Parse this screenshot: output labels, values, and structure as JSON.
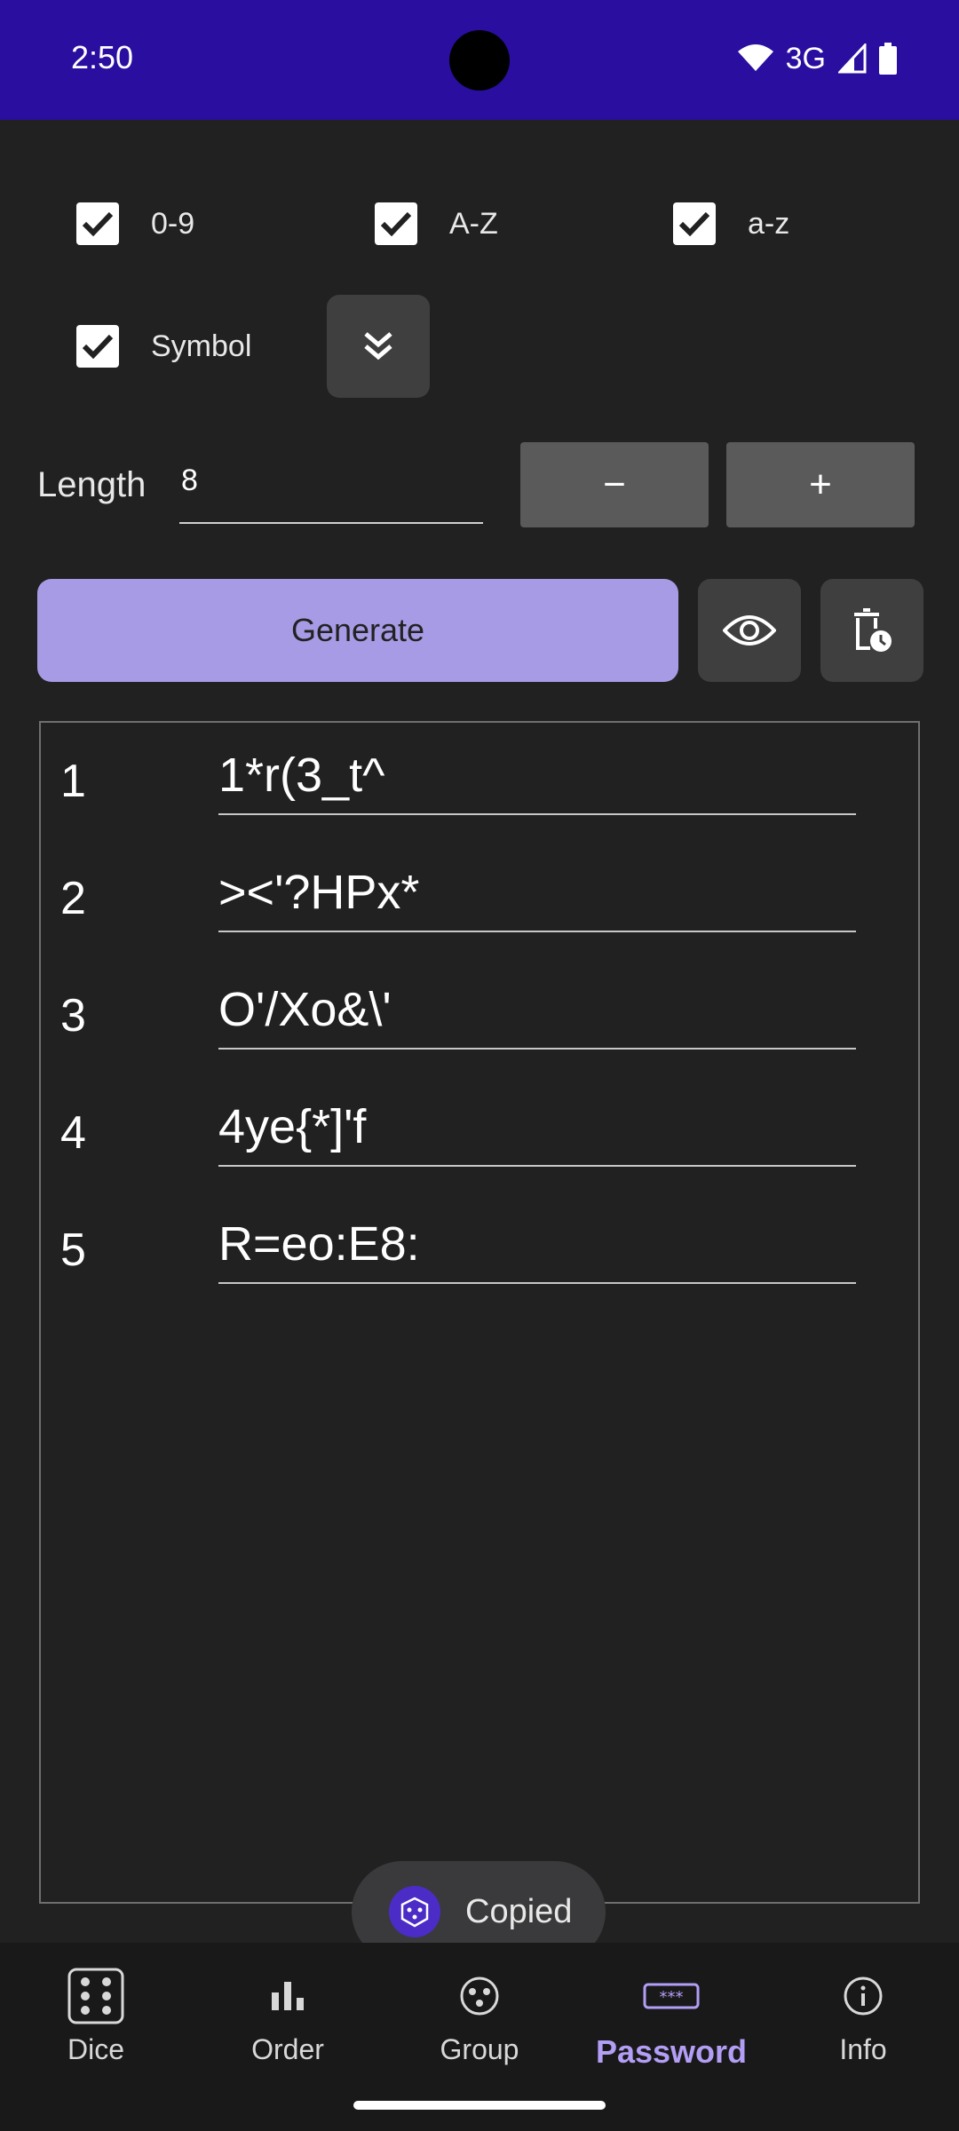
{
  "status_bar": {
    "time": "2:50",
    "network": "3G"
  },
  "options": {
    "digits": {
      "label": "0-9",
      "checked": true
    },
    "upper": {
      "label": "A-Z",
      "checked": true
    },
    "lower": {
      "label": "a-z",
      "checked": true
    },
    "symbol": {
      "label": "Symbol",
      "checked": true
    }
  },
  "length": {
    "label": "Length",
    "value": "8",
    "decrement": "−",
    "increment": "+"
  },
  "generate_label": "Generate",
  "passwords": [
    {
      "index": "1",
      "value": "1*r(3_t^"
    },
    {
      "index": "2",
      "value": "><'?HPx*"
    },
    {
      "index": "3",
      "value": "O'/Xo&\\'"
    },
    {
      "index": "4",
      "value": "4ye{*]'f"
    },
    {
      "index": "5",
      "value": "R=eo:E8:"
    }
  ],
  "toast": {
    "text": "Copied",
    "icon": "dice-icon"
  },
  "nav": {
    "items": [
      {
        "label": "Dice",
        "icon": "dice-icon"
      },
      {
        "label": "Order",
        "icon": "bar-chart-icon"
      },
      {
        "label": "Group",
        "icon": "group-icon"
      },
      {
        "label": "Password",
        "icon": "password-icon",
        "active": true
      },
      {
        "label": "Info",
        "icon": "info-icon"
      }
    ]
  },
  "colors": {
    "status_bar": "#2a0ea0",
    "background": "#212121",
    "accent": "#a89be6",
    "active_nav": "#b39ef5"
  }
}
